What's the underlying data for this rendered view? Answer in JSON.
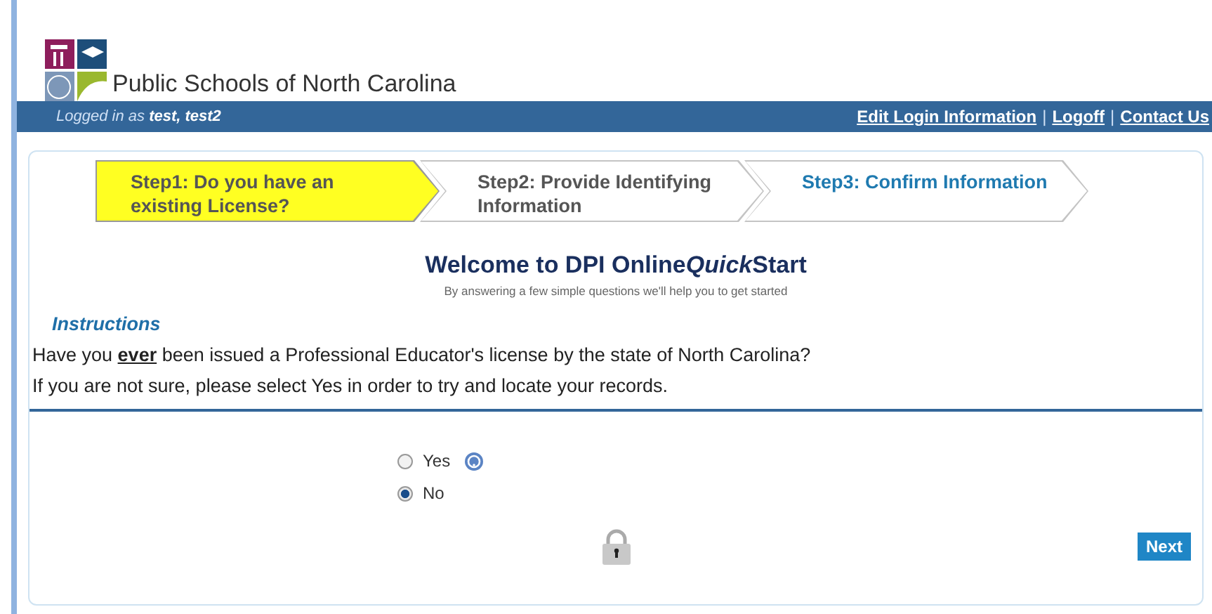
{
  "header": {
    "site_name": "Public Schools of North Carolina"
  },
  "login_bar": {
    "prefix": "Logged in as",
    "user": "test, test2",
    "links": [
      "Edit Login Information",
      "Logoff",
      "Contact Us"
    ],
    "separator": "|"
  },
  "steps": [
    {
      "label": "Step1: Do you have an existing License?",
      "selected": true,
      "kind": "current"
    },
    {
      "label": "Step2: Provide Identifying Information",
      "selected": false,
      "kind": "pending"
    },
    {
      "label": "Step3: Confirm Information",
      "selected": false,
      "kind": "final"
    }
  ],
  "title": {
    "start": "Welcome to DPI Online",
    "emphasis": "Quick",
    "end": "Start"
  },
  "subtitle": "By answering a few simple questions we'll help you to get started",
  "instructions_heading": "Instructions",
  "instructions": [
    "Have you **ever** been issued a Professional Educator's license by the state of North Carolina?",
    "If you are not sure, please select Yes in order to try and locate your records."
  ],
  "options": [
    {
      "label": "Yes",
      "selected": false,
      "help": true
    },
    {
      "label": "No",
      "selected": true,
      "help": false
    }
  ],
  "next_button": "Next"
}
